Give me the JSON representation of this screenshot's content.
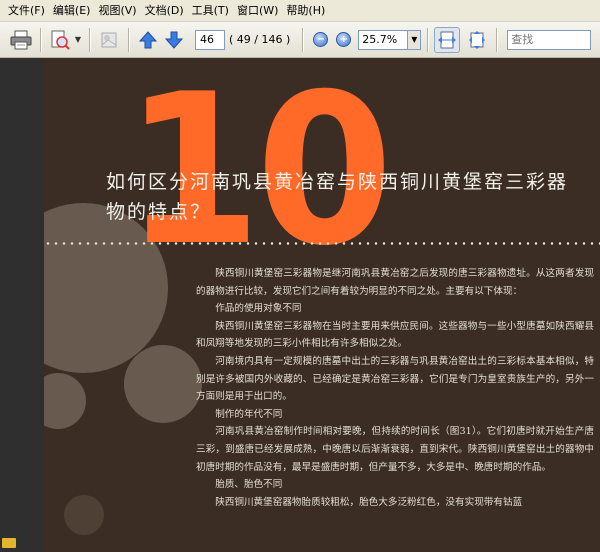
{
  "menu": {
    "items": [
      "文件(F)",
      "编辑(E)",
      "视图(V)",
      "文档(D)",
      "工具(T)",
      "窗口(W)",
      "帮助(H)"
    ]
  },
  "toolbar": {
    "page_number": "46",
    "page_count": "( 49 / 146 )",
    "zoom": "25.7%",
    "search_placeholder": "查找",
    "icons": [
      "printer-icon",
      "page-zoom-icon",
      "crop-icon",
      "arrow-up-icon",
      "arrow-down-icon",
      "zoom-out-icon",
      "zoom-in-icon",
      "fit-width-icon",
      "fit-page-icon",
      "folder-icon"
    ],
    "colors": {
      "arrow": "#3d7be0"
    }
  },
  "document": {
    "chapter_number": "10",
    "title": "如何区分河南巩县黄冶窑与陕西铜川黄堡窑三彩器物的特点？",
    "paragraphs": [
      "陕西铜川黄堡窑三彩器物是继河南巩县黄冶窑之后发现的唐三彩器物遗址。从这两者发现的器物进行比较，发现它们之间有着较为明显的不同之处。主要有以下体现：",
      "作品的使用对象不同",
      "陕西铜川黄堡窑三彩器物在当时主要用来供应民间。这些器物与一些小型唐墓如陕西耀县和凤翔等地发现的三彩小件相比有许多相似之处。",
      "河南境内具有一定规模的唐墓中出土的三彩器与巩县黄冶窑出土的三彩标本基本相似，特别是许多被国内外收藏的、已经确定是黄冶窑三彩器，它们是专门为皇室贵族生产的，另外一方面则是用于出口的。",
      "制作的年代不同",
      "河南巩县黄冶窑制作时间相对要晚，但持续的时间长（图31）。它们初唐时就开始生产唐三彩，到盛唐已经发展成熟，中晚唐以后渐渐衰弱，直到宋代。陕西铜川黄堡窑出土的器物中初唐时期的作品没有，最早是盛唐时期，但产量不多，大多是中、晚唐时期的作品。",
      "胎质、胎色不同",
      "陕西铜川黄堡窑器物胎质较粗松，胎色大多泛粉红色，没有实现带有钴蓝"
    ],
    "colors": {
      "background": "#3b2d23",
      "accent": "#ff6a28",
      "text": "#e3ddd2"
    }
  }
}
